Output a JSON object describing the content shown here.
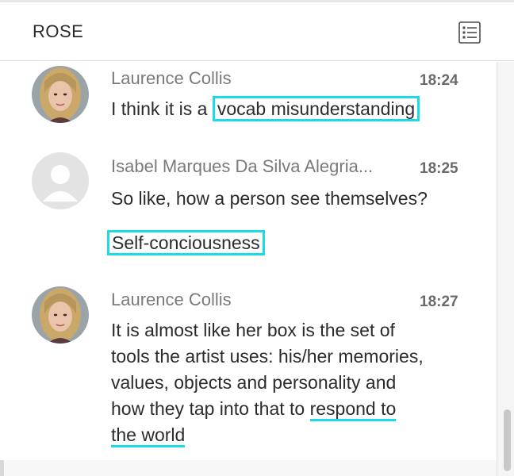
{
  "header": {
    "title": "ROSE",
    "list_icon": "list-icon"
  },
  "colors": {
    "highlight": "#19dce8",
    "name_gray": "#7a7a7a",
    "text": "#2b2b2b"
  },
  "messages": [
    {
      "author": "Laurence Collis",
      "time": "18:24",
      "text_prefix": "I think it is a ",
      "text_highlight": "vocab misunderstanding",
      "avatar": "woman-photo-avatar"
    },
    {
      "author": "Isabel Marques Da Silva Alegria...",
      "time": "18:25",
      "text": "So like, how a person see themselves?",
      "text_extra": "Self-conciousness",
      "avatar": "default-user-avatar"
    },
    {
      "author": "Laurence Collis",
      "time": "18:27",
      "lines": [
        "It is almost like her box is the set of",
        "tools the artist uses: his/her memories,",
        "values, objects and personality and",
        "how they tap into that to "
      ],
      "line4_highlight": "respond to",
      "line5_highlight": "the world",
      "avatar": "woman-photo-avatar"
    }
  ]
}
